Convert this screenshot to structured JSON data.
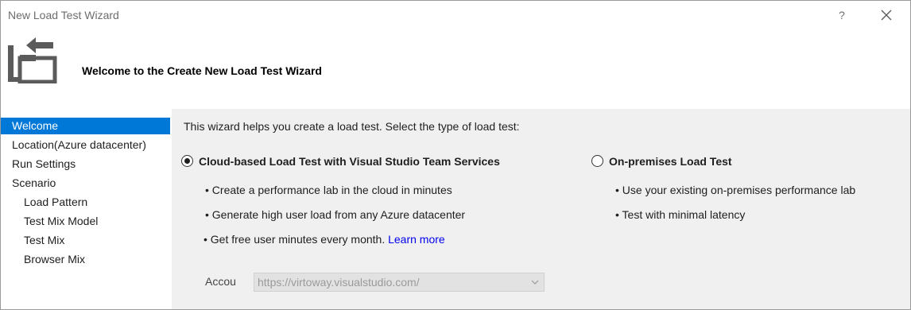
{
  "window": {
    "title": "New Load Test Wizard",
    "help_label": "?"
  },
  "header": {
    "title": "Welcome to the Create New Load Test Wizard"
  },
  "nav": {
    "items": [
      {
        "label": "Welcome",
        "selected": true
      },
      {
        "label": "Location(Azure datacenter)"
      },
      {
        "label": "Run Settings"
      },
      {
        "label": "Scenario"
      },
      {
        "label": "Load Pattern"
      },
      {
        "label": "Test Mix Model"
      },
      {
        "label": "Test Mix"
      },
      {
        "label": "Browser Mix"
      }
    ]
  },
  "content": {
    "intro": "This wizard helps you create a load test. Select the type of load test:",
    "cloud": {
      "label": "Cloud-based Load Test with Visual Studio Team Services",
      "selected": true,
      "bullets": [
        "• Create a performance lab in the cloud in minutes",
        "• Generate high user load from any Azure datacenter",
        "• Get free user minutes every month."
      ],
      "learn_more": "Learn more"
    },
    "onprem": {
      "label": "On-premises Load Test",
      "selected": false,
      "bullets": [
        "• Use your existing on-premises performance lab",
        "• Test with minimal latency"
      ]
    },
    "account": {
      "label": "Accou",
      "value": "https://virtoway.visualstudio.com/"
    }
  },
  "colors": {
    "selection": "#0078d7",
    "panel": "#f0f0f0",
    "link": "#0000ee"
  }
}
